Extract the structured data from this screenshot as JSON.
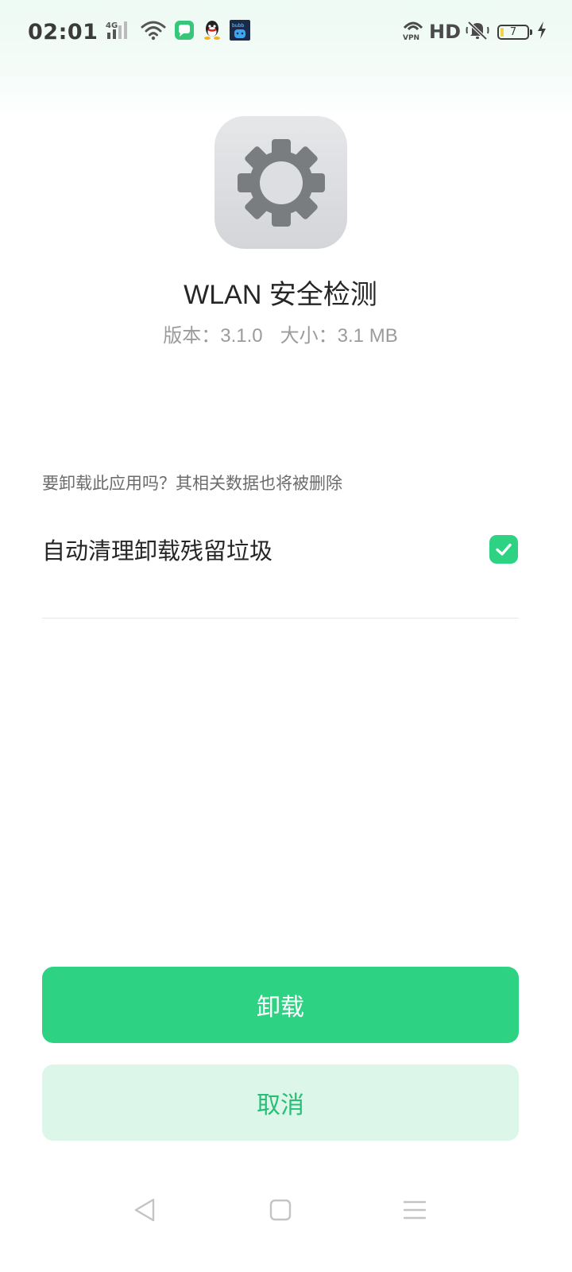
{
  "status_bar": {
    "time": "02:01",
    "hd_label": "HD",
    "vpn_label": "VPN",
    "battery_level": "7",
    "icons": [
      "4g-signal-icon",
      "wifi-icon",
      "message-app-icon",
      "qq-app-icon",
      "game-app-icon",
      "vpn-icon",
      "mute-bell-icon",
      "battery-icon",
      "charging-icon"
    ]
  },
  "app": {
    "icon": "gear-icon",
    "name": "WLAN 安全检测",
    "version": "版本：3.1.0",
    "size": "大小：3.1 MB"
  },
  "dialog": {
    "question": "要卸载此应用吗？其相关数据也将被删除",
    "auto_clean_label": "自动清理卸载残留垃圾",
    "auto_clean_checked": true
  },
  "buttons": {
    "uninstall_label": "卸载",
    "cancel_label": "取消"
  },
  "nav": {
    "icons": [
      "back-icon",
      "home-icon",
      "menu-icon"
    ]
  },
  "colors": {
    "accent": "#2dd383",
    "cancel_bg": "#dcf6ea",
    "cancel_text": "#27bf76"
  }
}
